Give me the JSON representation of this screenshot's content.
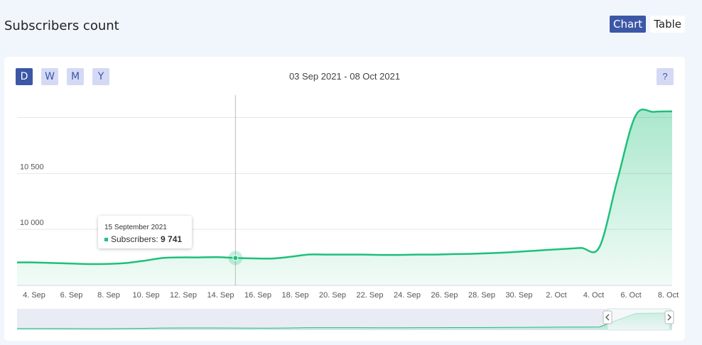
{
  "header": {
    "title": "Subscribers count"
  },
  "view_toggle": {
    "chart_label": "Chart",
    "table_label": "Table",
    "active": "chart"
  },
  "controls": {
    "periods": [
      "D",
      "W",
      "M",
      "Y"
    ],
    "active_period": "D",
    "date_range": "03 Sep 2021 - 08 Oct 2021",
    "help_label": "?"
  },
  "colors": {
    "line": "#1ec07a",
    "accent": "#3c57a6",
    "button_bg": "#d4daf5"
  },
  "tooltip": {
    "date": "15 September 2021",
    "series_label": "Subscribers:",
    "value_text": "9 741"
  },
  "chart_data": {
    "type": "area",
    "x_labels": [
      "4. Sep",
      "6. Sep",
      "8. Sep",
      "10. Sep",
      "12. Sep",
      "14. Sep",
      "16. Sep",
      "18. Sep",
      "20. Sep",
      "22. Sep",
      "24. Sep",
      "26. Sep",
      "28. Sep",
      "30. Sep",
      "2. Oct",
      "4. Oct",
      "6. Oct",
      "8. Oct"
    ],
    "y_ticks": [
      {
        "value": 10000,
        "label": "10 000"
      },
      {
        "value": 10500,
        "label": "10 500"
      },
      {
        "value": 11000,
        "label": ""
      }
    ],
    "ylim": [
      9500,
      11200
    ],
    "series": [
      {
        "values": [
          9705,
          9705,
          9700,
          9695,
          9690,
          9692,
          9700,
          9720,
          9745,
          9750,
          9750,
          9752,
          9745,
          9741,
          9740,
          9755,
          9775,
          9775,
          9775,
          9775,
          9772,
          9772,
          9775,
          9775,
          9780,
          9782,
          9788,
          9795,
          9805,
          9815,
          9825,
          9835,
          9842,
          10450,
          11020,
          11050,
          11055
        ]
      }
    ],
    "highlight_index": 12,
    "grid": true
  }
}
